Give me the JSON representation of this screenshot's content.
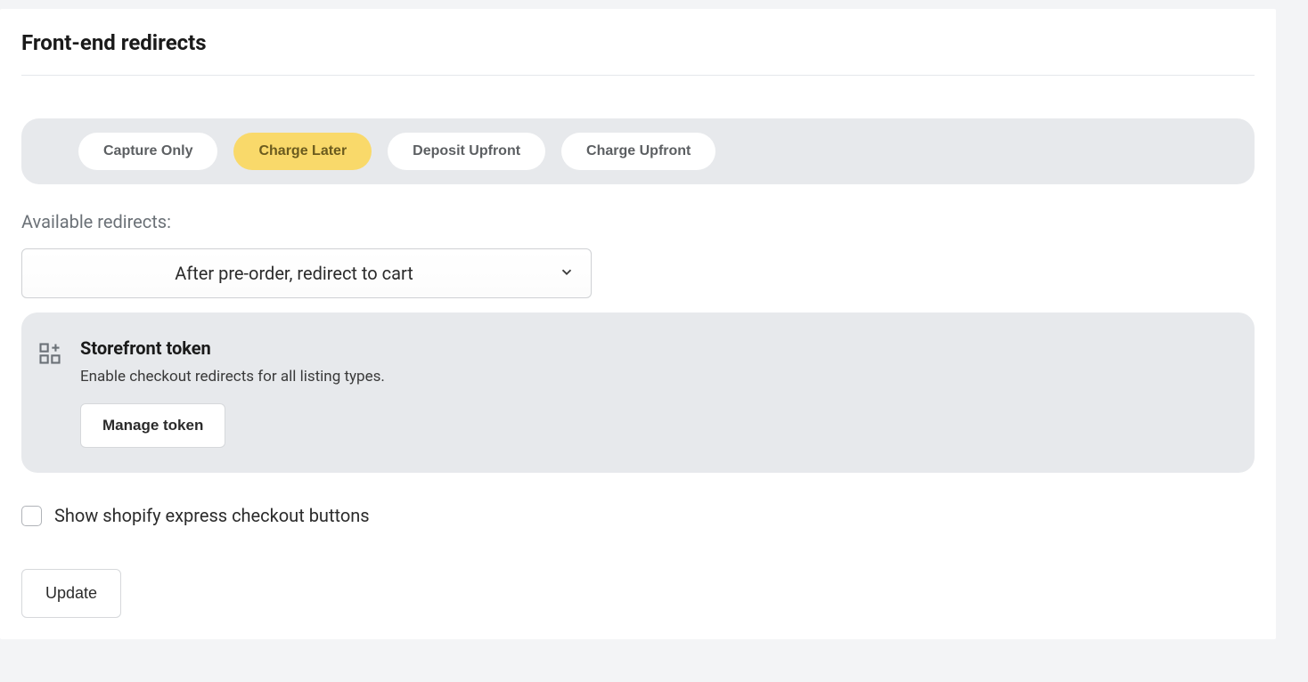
{
  "page": {
    "title": "Front-end redirects"
  },
  "tabs": {
    "items": [
      {
        "label": "Capture Only",
        "name": "tab-capture-only"
      },
      {
        "label": "Charge Later",
        "name": "tab-charge-later"
      },
      {
        "label": "Deposit Upfront",
        "name": "tab-deposit-upfront"
      },
      {
        "label": "Charge Upfront",
        "name": "tab-charge-upfront"
      }
    ],
    "active_index": 1
  },
  "redirects": {
    "label": "Available redirects:",
    "selected": "After pre-order, redirect to cart"
  },
  "token": {
    "title": "Storefront token",
    "description": "Enable checkout redirects for all listing types.",
    "button_label": "Manage token"
  },
  "express_checkbox": {
    "label": "Show shopify express checkout buttons",
    "checked": false
  },
  "actions": {
    "update_label": "Update"
  }
}
